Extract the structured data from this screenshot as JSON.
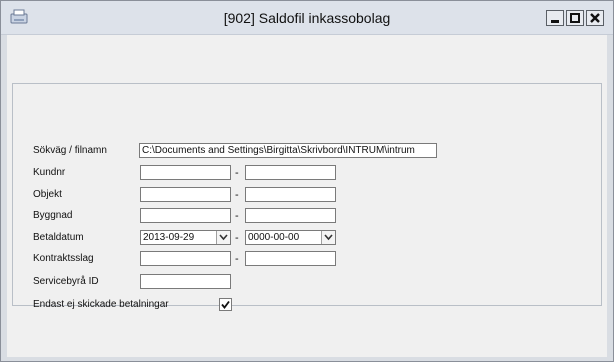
{
  "window": {
    "title": "[902]  Saldofil inkassobolag"
  },
  "form": {
    "path": {
      "label": "Sökväg / filnamn",
      "value": "C:\\Documents and Settings\\Birgitta\\Skrivbord\\INTRUM\\intrum"
    },
    "kundnr": {
      "label": "Kundnr",
      "from": "",
      "to": ""
    },
    "objekt": {
      "label": "Objekt",
      "from": "",
      "to": ""
    },
    "byggnad": {
      "label": "Byggnad",
      "from": "",
      "to": ""
    },
    "betaldatum": {
      "label": "Betaldatum",
      "from": "2013-09-29",
      "to": "0000-00-00"
    },
    "kontraktsslag": {
      "label": "Kontraktsslag",
      "from": "",
      "to": ""
    },
    "servicebyra": {
      "label": "Servicebyrå ID",
      "value": ""
    },
    "endast": {
      "label": "Endast ej skickade betalningar",
      "checked": true
    },
    "range_sep": "-"
  }
}
